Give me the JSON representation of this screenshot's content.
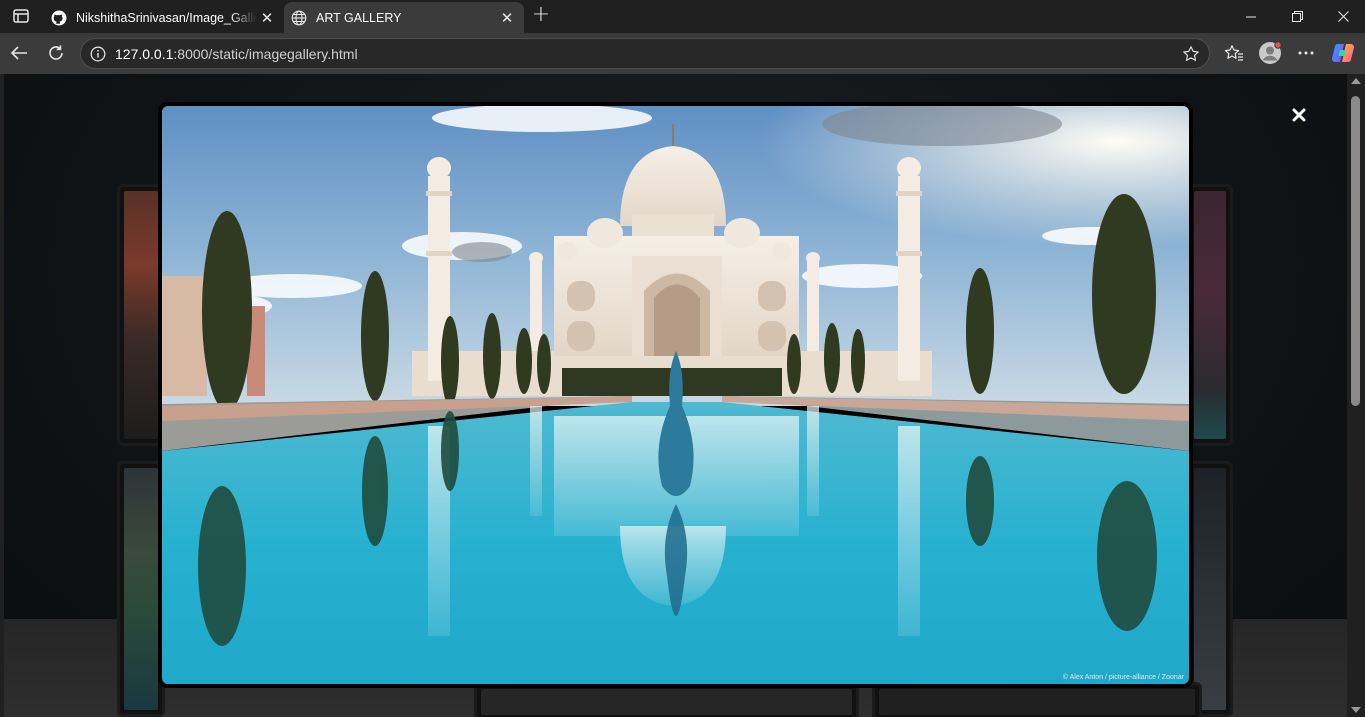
{
  "browser": {
    "tabs": [
      {
        "title": "NikshithaSrinivasan/Image_Gallery",
        "favicon": "github-icon",
        "active": false
      },
      {
        "title": "ART GALLERY",
        "favicon": "globe-icon",
        "active": true
      }
    ],
    "address": {
      "host": "127.0.0.1",
      "rest": ":8000/static/imagegallery.html"
    }
  },
  "lightbox": {
    "image_subject": "Taj Mahal reflected in pool",
    "credit": "© Alex Anton / picture-alliance / Zoonar",
    "close_icon": "close-icon"
  },
  "colors": {
    "sky": "#8eb6d9",
    "water": "#2fb3cf",
    "marble": "#efe6dc",
    "page_bg": "#111416"
  }
}
